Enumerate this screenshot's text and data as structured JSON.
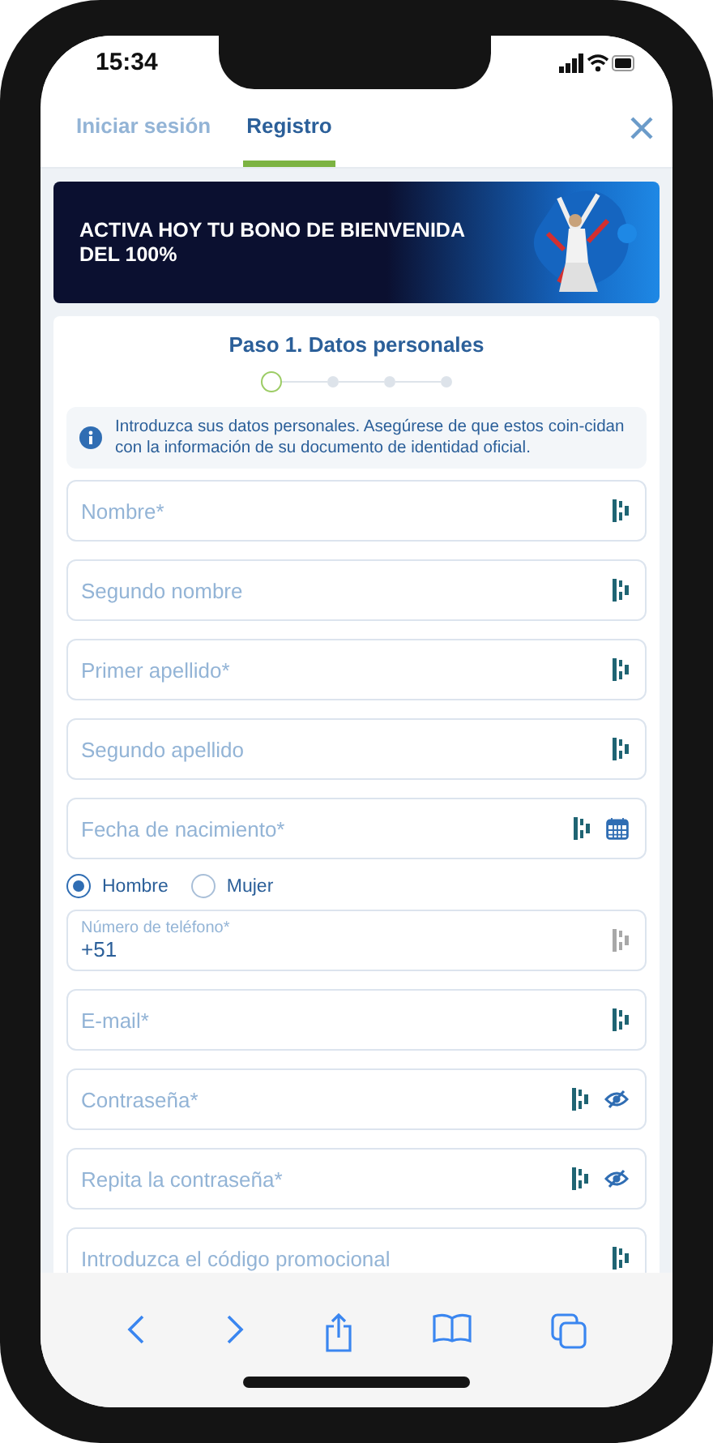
{
  "status_bar": {
    "time": "15:34"
  },
  "tabs": [
    {
      "label": "Iniciar sesión",
      "selected": false
    },
    {
      "label": "Registro",
      "selected": true
    }
  ],
  "banner": {
    "text": "ACTIVA HOY TU BONO DE BIENVENIDA DEL 100%"
  },
  "step": {
    "title": "Paso 1. Datos personales",
    "steps": [
      {
        "current": true
      },
      {
        "current": false
      },
      {
        "current": false
      },
      {
        "current": false
      }
    ]
  },
  "info": "Introduzca sus datos personales. Asegúrese de que estos coin-cidan con la información de su documento de identidad oficial.",
  "fields": [
    {
      "kind": "text",
      "placeholder": "Nombre*"
    },
    {
      "kind": "text",
      "placeholder": "Segundo nombre"
    },
    {
      "kind": "text",
      "placeholder": "Primer apellido*"
    },
    {
      "kind": "text",
      "placeholder": "Segundo apellido"
    },
    {
      "kind": "date",
      "placeholder": "Fecha de nacimiento*"
    }
  ],
  "gender": [
    {
      "label": "Hombre",
      "selected": true
    },
    {
      "label": "Mujer",
      "selected": false
    }
  ],
  "more_fields": [
    {
      "kind": "phone",
      "label": "Número de teléfono*",
      "value": "+51"
    },
    {
      "kind": "text",
      "placeholder": "E-mail*"
    },
    {
      "kind": "password",
      "placeholder": "Contraseña*"
    },
    {
      "kind": "password",
      "placeholder": "Repita la contraseña*"
    },
    {
      "kind": "text",
      "placeholder": "Introduzca el código promocional"
    }
  ]
}
